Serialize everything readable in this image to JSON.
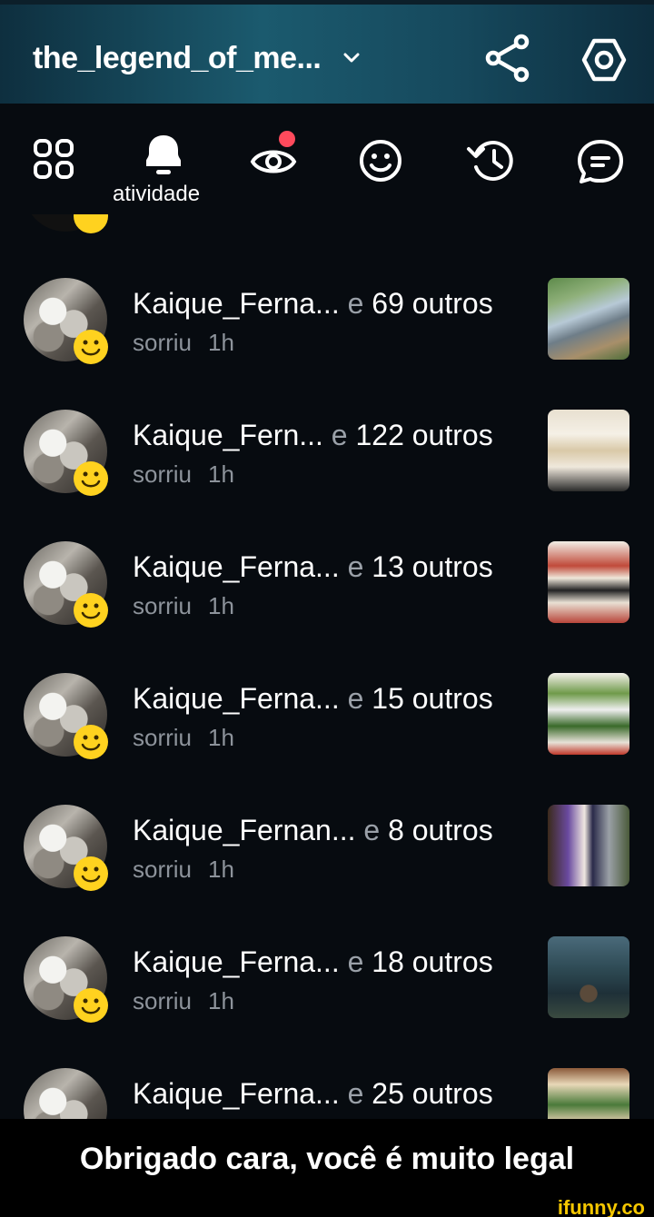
{
  "header": {
    "title": "the_legend_of_me...",
    "icons": [
      "chevron-down-icon",
      "share-icon",
      "settings-icon"
    ]
  },
  "tabs": {
    "active_label": "atividade",
    "items": [
      "grid-icon",
      "bell-icon",
      "eye-icon",
      "smiley-icon",
      "history-icon",
      "chat-icon"
    ]
  },
  "activity": {
    "rows": [
      {
        "name": "Kaique_Ferna...",
        "connector": "e",
        "others": "69 outros",
        "action": "sorriu",
        "time": "1h"
      },
      {
        "name": "Kaique_Fern...",
        "connector": "e",
        "others": "122 outros",
        "action": "sorriu",
        "time": "1h"
      },
      {
        "name": "Kaique_Ferna...",
        "connector": "e",
        "others": "13 outros",
        "action": "sorriu",
        "time": "1h"
      },
      {
        "name": "Kaique_Ferna...",
        "connector": "e",
        "others": "15 outros",
        "action": "sorriu",
        "time": "1h"
      },
      {
        "name": "Kaique_Fernan...",
        "connector": "e",
        "others": "8 outros",
        "action": "sorriu",
        "time": "1h"
      },
      {
        "name": "Kaique_Ferna...",
        "connector": "e",
        "others": "18 outros",
        "action": "sorriu",
        "time": "1h"
      },
      {
        "name": "Kaique_Ferna...",
        "connector": "e",
        "others": "25 outros",
        "action": "",
        "time": ""
      }
    ]
  },
  "caption": {
    "text": "Obrigado cara, você é muito legal"
  },
  "watermark": {
    "text": "ifunny.co"
  },
  "colors": {
    "accent_dot": "#ff4a5c",
    "smiley": "#ffd21f",
    "watermark": "#f6c700"
  }
}
